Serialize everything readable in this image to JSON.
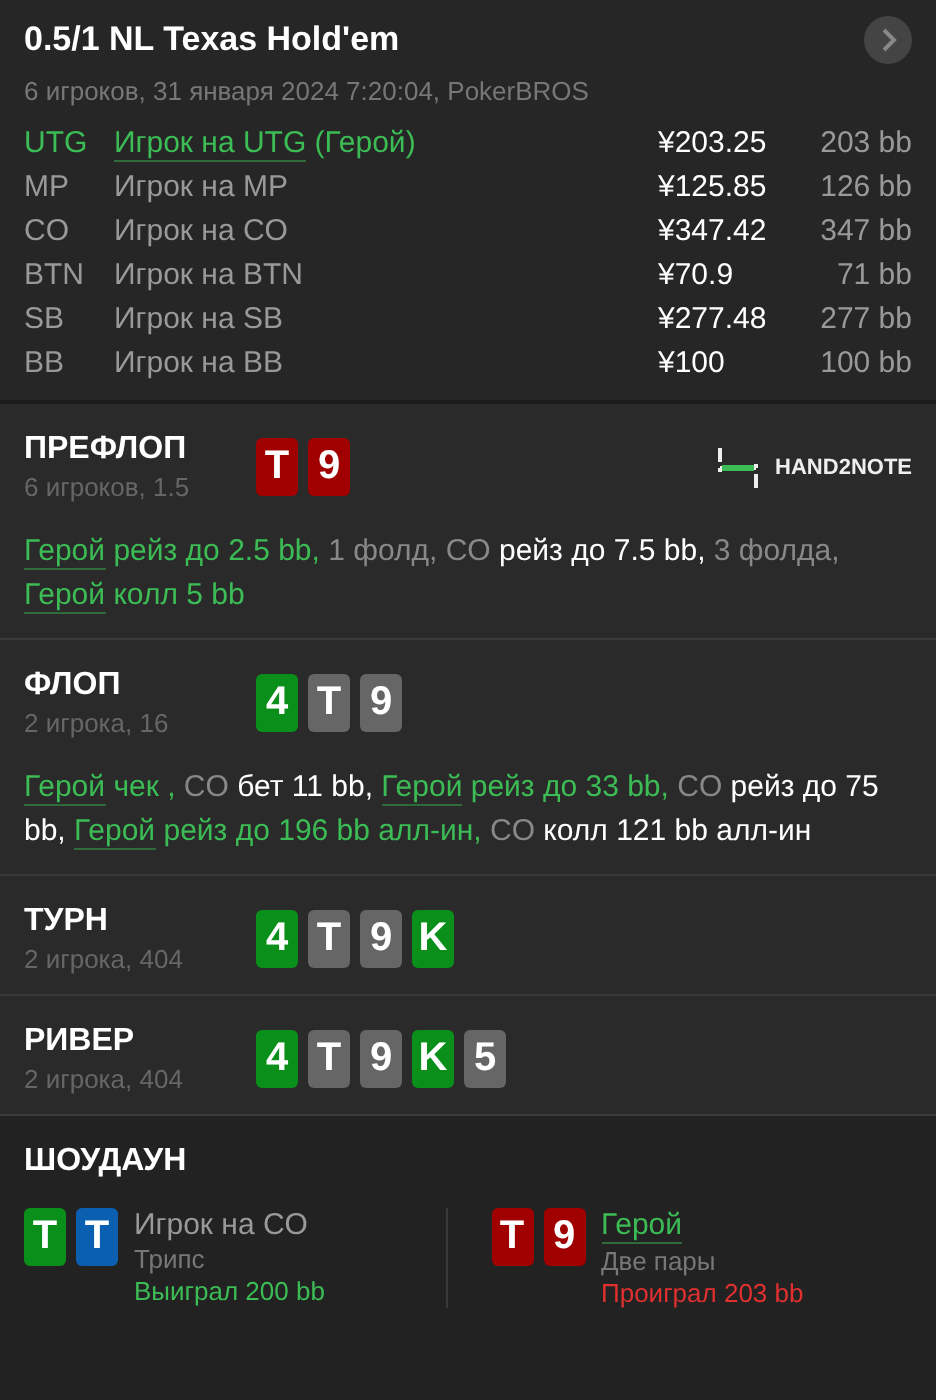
{
  "header": {
    "title": "0.5/1 NL Texas Hold'em",
    "subtitle": "6 игроков, 31 января 2024 7:20:04, PokerBROS"
  },
  "players": [
    {
      "position": "UTG",
      "name": "Игрок на UTG",
      "note": "(Герой)",
      "hero": true,
      "stack": "¥203.25",
      "bb": "203 bb"
    },
    {
      "position": "MP",
      "name": "Игрок на MP",
      "hero": false,
      "stack": "¥125.85",
      "bb": "126 bb"
    },
    {
      "position": "CO",
      "name": "Игрок на CO",
      "hero": false,
      "stack": "¥347.42",
      "bb": "347 bb"
    },
    {
      "position": "BTN",
      "name": "Игрок на BTN",
      "hero": false,
      "stack": "¥70.9",
      "bb": "71 bb"
    },
    {
      "position": "SB",
      "name": "Игрок на SB",
      "hero": false,
      "stack": "¥277.48",
      "bb": "277 bb"
    },
    {
      "position": "BB",
      "name": "Игрок на BB",
      "hero": false,
      "stack": "¥100",
      "bb": "100 bb"
    }
  ],
  "streets": [
    {
      "name": "ПРЕФЛОП",
      "info": "6 игроков, 1.5",
      "logo": "HAND2NOTE",
      "cards": [
        {
          "rank": "T",
          "color": "#a00000"
        },
        {
          "rank": "9",
          "color": "#a00000"
        }
      ],
      "actions": [
        {
          "kind": "hero",
          "text": "Герой"
        },
        {
          "kind": "green",
          "text": " рейз до 2.5 bb,"
        },
        {
          "kind": "grey",
          "text": " 1 фолд, CO"
        },
        {
          "kind": "white",
          "text": " рейз до 7.5 bb,"
        },
        {
          "kind": "grey",
          "text": " 3 фолда, "
        },
        {
          "kind": "hero",
          "text": "Герой"
        },
        {
          "kind": "green",
          "text": " колл 5 bb"
        }
      ]
    },
    {
      "name": "ФЛОП",
      "info": "2 игрока, 16",
      "cards": [
        {
          "rank": "4",
          "color": "#0a8f1a"
        },
        {
          "rank": "T",
          "color": "#666666"
        },
        {
          "rank": "9",
          "color": "#666666"
        }
      ],
      "actions": [
        {
          "kind": "hero",
          "text": "Герой"
        },
        {
          "kind": "green",
          "text": " чек ,"
        },
        {
          "kind": "grey",
          "text": " CO"
        },
        {
          "kind": "white",
          "text": " бет 11 bb, "
        },
        {
          "kind": "hero",
          "text": "Герой"
        },
        {
          "kind": "green",
          "text": " рейз до 33 bb,"
        },
        {
          "kind": "grey",
          "text": " CO"
        },
        {
          "kind": "white",
          "text": " рейз до 75 bb, "
        },
        {
          "kind": "hero",
          "text": "Герой"
        },
        {
          "kind": "green",
          "text": " рейз до 196 bb алл-ин,"
        },
        {
          "kind": "grey",
          "text": " CO"
        },
        {
          "kind": "white",
          "text": " колл 121 bb алл-ин"
        }
      ]
    },
    {
      "name": "ТУРН",
      "info": "2 игрока, 404",
      "cards": [
        {
          "rank": "4",
          "color": "#0a8f1a"
        },
        {
          "rank": "T",
          "color": "#666666"
        },
        {
          "rank": "9",
          "color": "#666666"
        },
        {
          "rank": "K",
          "color": "#0a8f1a"
        }
      ]
    },
    {
      "name": "РИВЕР",
      "info": "2 игрока, 404",
      "cards": [
        {
          "rank": "4",
          "color": "#0a8f1a"
        },
        {
          "rank": "T",
          "color": "#666666"
        },
        {
          "rank": "9",
          "color": "#666666"
        },
        {
          "rank": "K",
          "color": "#0a8f1a"
        },
        {
          "rank": "5",
          "color": "#666666"
        }
      ]
    }
  ],
  "showdown": {
    "title": "ШОУДАУН",
    "players": [
      {
        "cards": [
          {
            "rank": "T",
            "color": "#0a8f1a"
          },
          {
            "rank": "T",
            "color": "#0b5fb0"
          }
        ],
        "name": "Игрок на CO",
        "hero": false,
        "hand": "Трипс",
        "result": "Выиграл 200 bb",
        "won": true
      },
      {
        "cards": [
          {
            "rank": "T",
            "color": "#a00000"
          },
          {
            "rank": "9",
            "color": "#a00000"
          }
        ],
        "name": "Герой",
        "hero": true,
        "hand": "Две пары",
        "result": "Проиграл 203 bb",
        "won": false
      }
    ]
  }
}
